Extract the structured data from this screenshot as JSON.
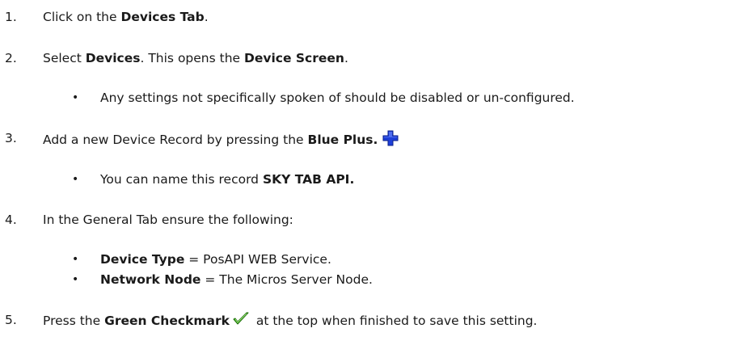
{
  "steps": [
    {
      "number": "1.",
      "parts": [
        "Click on the ",
        "Devices Tab",
        "."
      ]
    },
    {
      "number": "2.",
      "parts": [
        "Select ",
        "Devices",
        ". This opens the ",
        "Device Screen",
        "."
      ],
      "bullets": [
        {
          "text": "Any settings not specifically spoken of should be disabled or un-configured."
        }
      ]
    },
    {
      "number": "3.",
      "parts": [
        "Add a new Device Record by pressing the ",
        "Blue Plus."
      ],
      "icon": "blue-plus-icon",
      "icon_color": "#1e3fd8",
      "bullets": [
        {
          "parts": [
            "You can name this record ",
            "SKY TAB API."
          ]
        }
      ]
    },
    {
      "number": "4.",
      "parts": [
        "In the General Tab ensure the following:"
      ],
      "bullets": [
        {
          "parts": [
            "Device Type",
            " = PosAPI WEB Service."
          ]
        },
        {
          "parts": [
            "Network Node",
            " = The Micros Server Node."
          ]
        }
      ]
    },
    {
      "number": "5.",
      "parts": [
        "Press the ",
        "Green Checkmark",
        " at the top when finished to save this setting."
      ],
      "icon": "green-checkmark-icon",
      "icon_color": "#3cb31c"
    }
  ],
  "bullet_glyph": "•"
}
